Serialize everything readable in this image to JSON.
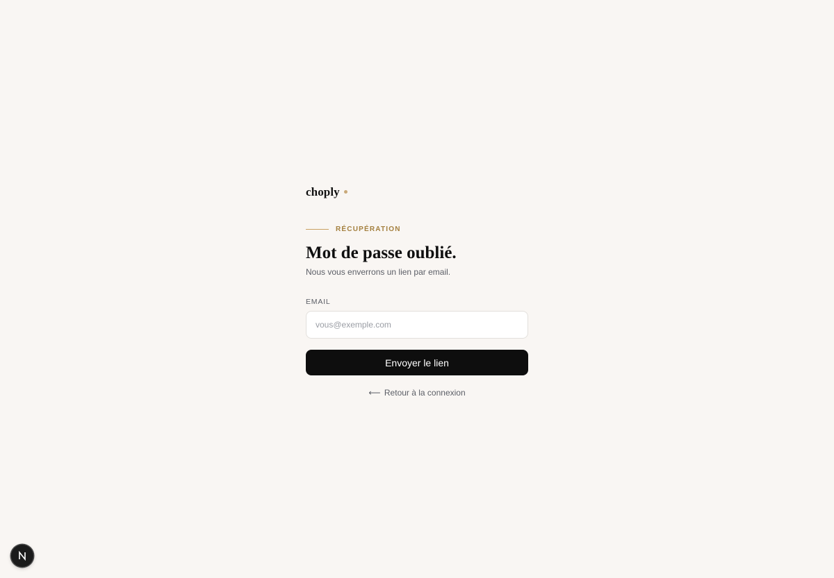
{
  "brand": {
    "name": "choply",
    "dot_color": "#c9a979"
  },
  "eyebrow": {
    "text": "RÉCUPÉRATION",
    "accent_color": "#a4803f"
  },
  "heading": {
    "title": "Mot de passe oublié.",
    "subtitle": "Nous vous enverrons un lien par email."
  },
  "form": {
    "email_label": "EMAIL",
    "email_placeholder": "vous@exemple.com",
    "email_value": "",
    "submit_label": "Envoyer le lien"
  },
  "back_link": {
    "arrow": "⟵",
    "label": "Retour à la connexion"
  },
  "devtools": {
    "icon": "nextjs-icon"
  },
  "colors": {
    "background": "#f9f6f3",
    "button": "#0e0e0e",
    "text_muted": "#5b5e66"
  }
}
